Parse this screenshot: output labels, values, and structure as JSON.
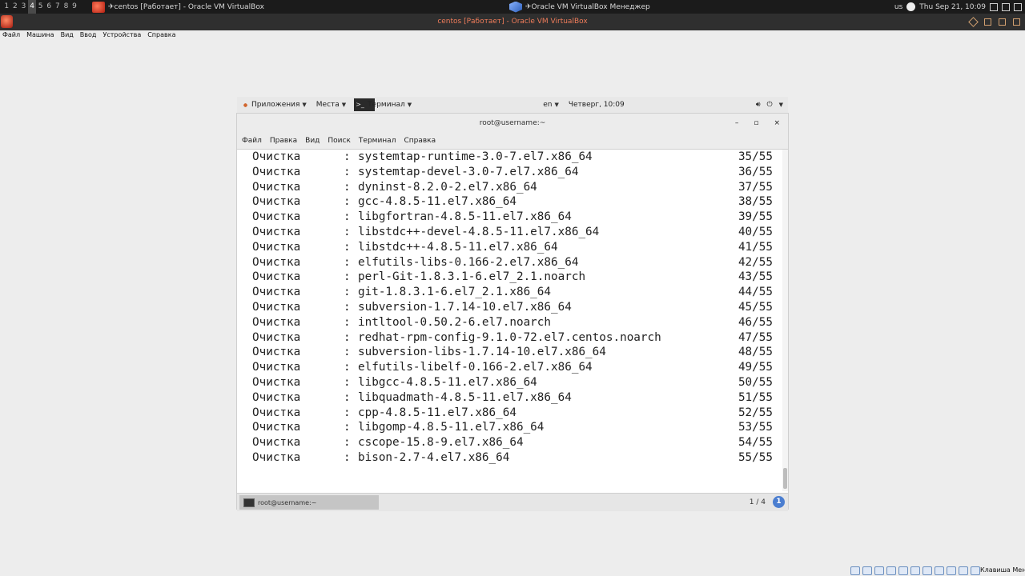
{
  "host": {
    "workspaces": [
      "1",
      "2",
      "3",
      "4",
      "5",
      "6",
      "7",
      "8",
      "9"
    ],
    "active_workspace": "4",
    "task_vm": "✈centos [Работает] - Oracle VM VirtualBox",
    "task_manager": "✈Oracle VM VirtualBox Менеджер",
    "kbd_layout": "us",
    "datetime": "Thu Sep 21, 10:09"
  },
  "vbox": {
    "window_title": "centos [Работает] - Oracle VM VirtualBox",
    "menu": [
      "Файл",
      "Машина",
      "Вид",
      "Ввод",
      "Устройства",
      "Справка"
    ],
    "status_label": "Клавиша Меню"
  },
  "guest_panel": {
    "apps": "Приложения",
    "places": "Места",
    "terminal": "Терминал",
    "lang": "en",
    "clock": "Четверг, 10:09"
  },
  "terminal": {
    "title": "root@username:~",
    "controls": [
      "–",
      "▫",
      "×"
    ],
    "menu": [
      "Файл",
      "Правка",
      "Вид",
      "Поиск",
      "Терминал",
      "Справка"
    ],
    "lines": [
      {
        "action": "Очистка",
        "pkg": "systemtap-runtime-3.0-7.el7.x86_64",
        "num": "35/55"
      },
      {
        "action": "Очистка",
        "pkg": "systemtap-devel-3.0-7.el7.x86_64",
        "num": "36/55"
      },
      {
        "action": "Очистка",
        "pkg": "dyninst-8.2.0-2.el7.x86_64",
        "num": "37/55"
      },
      {
        "action": "Очистка",
        "pkg": "gcc-4.8.5-11.el7.x86_64",
        "num": "38/55"
      },
      {
        "action": "Очистка",
        "pkg": "libgfortran-4.8.5-11.el7.x86_64",
        "num": "39/55"
      },
      {
        "action": "Очистка",
        "pkg": "libstdc++-devel-4.8.5-11.el7.x86_64",
        "num": "40/55"
      },
      {
        "action": "Очистка",
        "pkg": "libstdc++-4.8.5-11.el7.x86_64",
        "num": "41/55"
      },
      {
        "action": "Очистка",
        "pkg": "elfutils-libs-0.166-2.el7.x86_64",
        "num": "42/55"
      },
      {
        "action": "Очистка",
        "pkg": "perl-Git-1.8.3.1-6.el7_2.1.noarch",
        "num": "43/55"
      },
      {
        "action": "Очистка",
        "pkg": "git-1.8.3.1-6.el7_2.1.x86_64",
        "num": "44/55"
      },
      {
        "action": "Очистка",
        "pkg": "subversion-1.7.14-10.el7.x86_64",
        "num": "45/55"
      },
      {
        "action": "Очистка",
        "pkg": "intltool-0.50.2-6.el7.noarch",
        "num": "46/55"
      },
      {
        "action": "Очистка",
        "pkg": "redhat-rpm-config-9.1.0-72.el7.centos.noarch",
        "num": "47/55"
      },
      {
        "action": "Очистка",
        "pkg": "subversion-libs-1.7.14-10.el7.x86_64",
        "num": "48/55"
      },
      {
        "action": "Очистка",
        "pkg": "elfutils-libelf-0.166-2.el7.x86_64",
        "num": "49/55"
      },
      {
        "action": "Очистка",
        "pkg": "libgcc-4.8.5-11.el7.x86_64",
        "num": "50/55"
      },
      {
        "action": "Очистка",
        "pkg": "libquadmath-4.8.5-11.el7.x86_64",
        "num": "51/55"
      },
      {
        "action": "Очистка",
        "pkg": "cpp-4.8.5-11.el7.x86_64",
        "num": "52/55"
      },
      {
        "action": "Очистка",
        "pkg": "libgomp-4.8.5-11.el7.x86_64",
        "num": "53/55"
      },
      {
        "action": "Очистка",
        "pkg": "cscope-15.8-9.el7.x86_64",
        "num": "54/55"
      },
      {
        "action": "Очистка",
        "pkg": "bison-2.7-4.el7.x86_64",
        "num": "55/55"
      }
    ]
  },
  "guest_bottom": {
    "task_label": "root@username:~",
    "page_indicator": "1 / 4",
    "info_badge": "1"
  }
}
